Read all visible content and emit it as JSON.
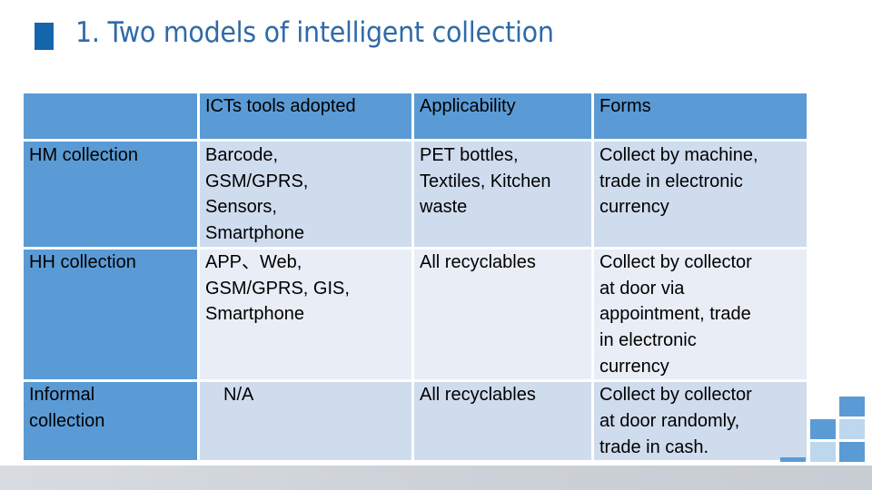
{
  "slide": {
    "title": "1. Two models of intelligent collection"
  },
  "table": {
    "headers": [
      "",
      "ICTs tools adopted",
      "Applicability",
      "Forms"
    ],
    "rows": [
      {
        "label": "HM collection",
        "ict_tools": "Barcode,\nGSM/GPRS,\nSensors,\nSmartphone",
        "applicability": "PET bottles,\nTextiles, Kitchen\nwaste",
        "forms": "Collect by machine,\ntrade in electronic\ncurrency"
      },
      {
        "label": "HH collection",
        "ict_tools": "APP、Web,\nGSM/GPRS, GIS,\nSmartphone",
        "applicability": "All recyclables",
        "forms": "Collect by collector\nat door via\nappointment, trade\nin electronic\ncurrency"
      },
      {
        "label": "Informal\ncollection",
        "ict_tools": "N/A",
        "applicability": "All recyclables",
        "forms": "Collect by collector\nat door randomly,\ntrade in cash."
      }
    ]
  },
  "colors": {
    "title": "#2f6aa8",
    "title_marker": "#1565ac",
    "header_fill": "#5b9bd5",
    "row_fill_dark": "#cfdcee",
    "row_fill_light": "#e8edf6",
    "deco_light": "#bdd7ee"
  }
}
